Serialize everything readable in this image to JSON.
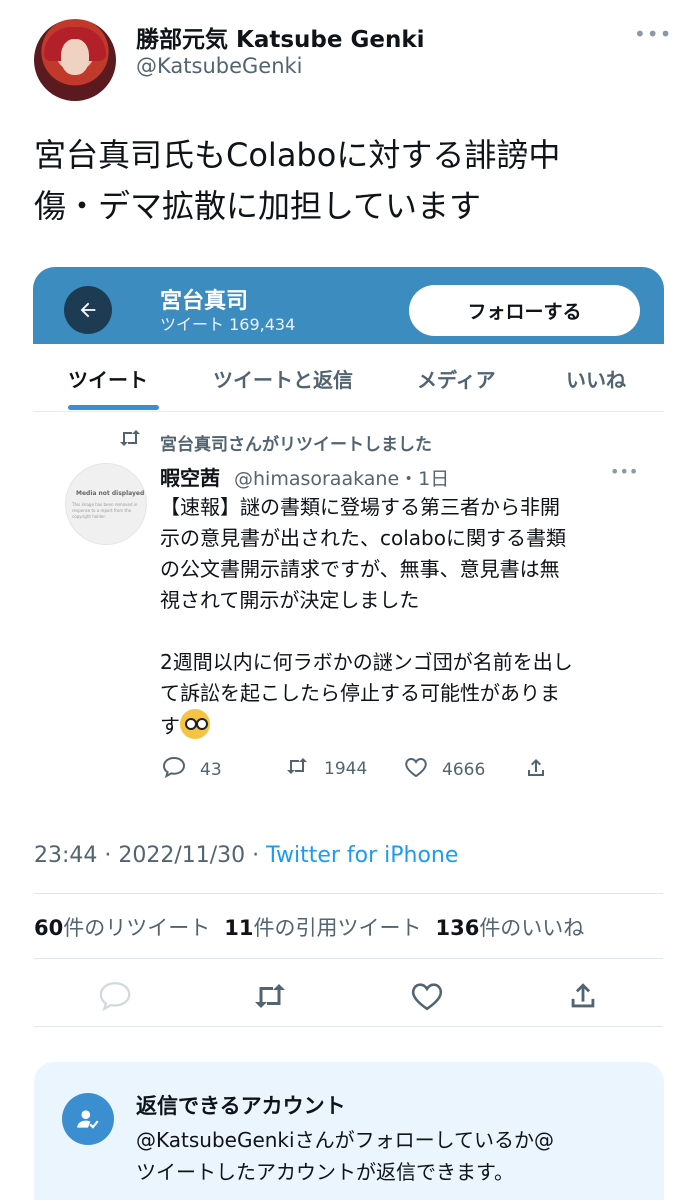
{
  "header": {
    "display_name": "勝部元気 Katsube Genki",
    "handle": "@KatsubeGenki",
    "more": "•••"
  },
  "tweet": {
    "line1": "宮台真司氏もColaboに対する誹謗中",
    "line2": "傷・デマ拡散に加担しています"
  },
  "embedded": {
    "profile_name": "宮台真司",
    "tweet_count": "ツイート 169,434",
    "follow_label": "フォローする",
    "tabs": [
      {
        "label": "ツイート"
      },
      {
        "label": "ツイートと返信"
      },
      {
        "label": "メディア"
      },
      {
        "label": "いいね"
      }
    ],
    "retweet_notice": "宮台真司さんがリツイートしました",
    "inner": {
      "avatar_placeholder": "Media not displayed",
      "avatar_sub": "This image has been removed in response to a report from the copyright holder.",
      "name": "暇空茜",
      "handle": "@himasoraakane・1日",
      "line1": "【速報】謎の書類に登場する第三者から非開",
      "line2": "示の意見書が出された、colaboに関する書類",
      "line3": "の公文書開示請求ですが、無事、意見書は無",
      "line4": "視されて開示が決定しました",
      "line5": "2週間以内に何ラボかの謎ンゴ団が名前を出し",
      "line6": "て訴訟を起こしたら停止する可能性がありま",
      "line7": "す",
      "replies": "43",
      "retweets": "1944",
      "likes": "4666"
    }
  },
  "meta": {
    "time": "23:44 · 2022/11/30 · ",
    "source": "Twitter for iPhone"
  },
  "stats": {
    "retweets_num": "60",
    "retweets_label": "件のリツイート",
    "quotes_num": "11",
    "quotes_label": "件の引用ツイート",
    "likes_num": "136",
    "likes_label": "件のいいね"
  },
  "reply_restriction": {
    "title": "返信できるアカウント",
    "desc_line1": "@KatsubeGenkiさんがフォローしているか@",
    "desc_line2": "ツイートしたアカウントが返信できます。"
  },
  "colors": {
    "accent": "#1d9bf0",
    "card_header": "#3d8cc0",
    "reply_box": "#eaf5fd"
  }
}
